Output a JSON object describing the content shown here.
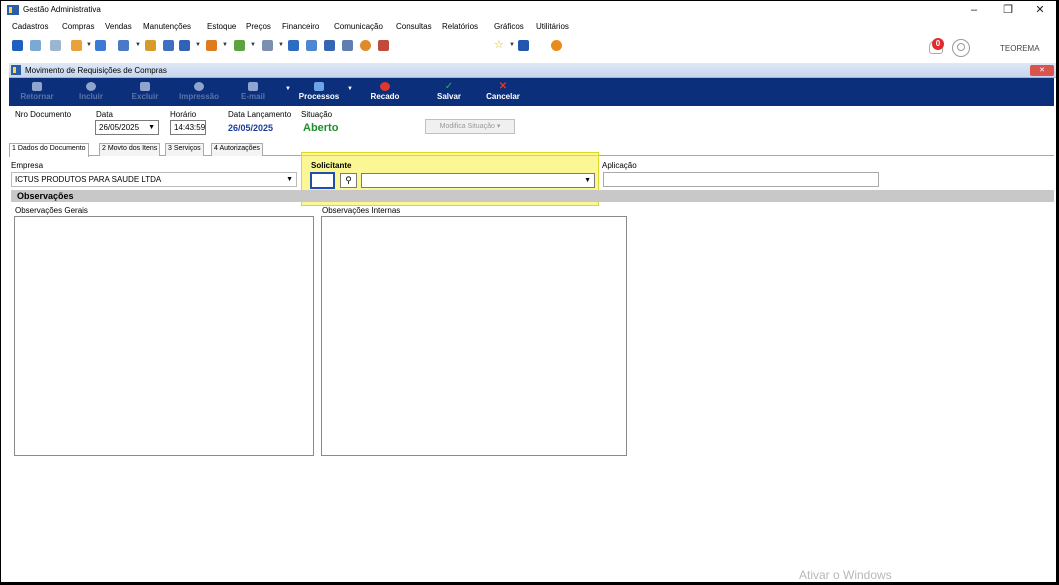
{
  "window": {
    "title": "Gestão Administrativa"
  },
  "menu": [
    "Cadastros",
    "Compras",
    "Vendas",
    "Manutenções",
    "Estoque",
    "Preços",
    "Financeiro",
    "Comunicação",
    "Consultas",
    "Relatórios",
    "Gráficos",
    "Utilitários"
  ],
  "toolbar": {
    "notification_count": "0",
    "company": "TEOREMA"
  },
  "child": {
    "title": "Movimento de Requisições de Compras"
  },
  "actions": [
    {
      "label": "Retornar",
      "enabled": false
    },
    {
      "label": "Incluir",
      "enabled": false
    },
    {
      "label": "Excluir",
      "enabled": false
    },
    {
      "label": "Impressão",
      "enabled": false
    },
    {
      "label": "E-mail",
      "enabled": false
    },
    {
      "label": "Processos",
      "enabled": true
    },
    {
      "label": "Recado",
      "enabled": true
    },
    {
      "label": "Salvar",
      "enabled": true
    },
    {
      "label": "Cancelar",
      "enabled": true
    }
  ],
  "header": {
    "nro_documento_label": "Nro Documento",
    "data_label": "Data",
    "data_value": "26/05/2025",
    "horario_label": "Horário",
    "horario_value": "14:43:59",
    "data_lancamento_label": "Data Lançamento",
    "data_lancamento_value": "26/05/2025",
    "situacao_label": "Situação",
    "situacao_value": "Aberto",
    "modifica_button": "Modifica Situação"
  },
  "tabs": [
    "1 Dados do Documento",
    "2 Movto dos Itens",
    "3 Serviços",
    "4 Autorizações"
  ],
  "form": {
    "empresa_label": "Empresa",
    "empresa_value": "ICTUS PRODUTOS PARA SAUDE LTDA",
    "solicitante_label": "Solicitante",
    "solicitante_code": "",
    "solicitante_value": "",
    "aplicacao_label": "Aplicação",
    "aplicacao_value": ""
  },
  "observacoes": {
    "header": "Observações",
    "gerais_label": "Observações Gerais",
    "internas_label": "Observações Internas"
  },
  "watermark": "Ativar o Windows",
  "colors": {
    "action_bar": "#0b2f7a",
    "highlight": "#f6f03c",
    "situacao": "#1d8f2d",
    "date_value": "#1a3c9a"
  }
}
